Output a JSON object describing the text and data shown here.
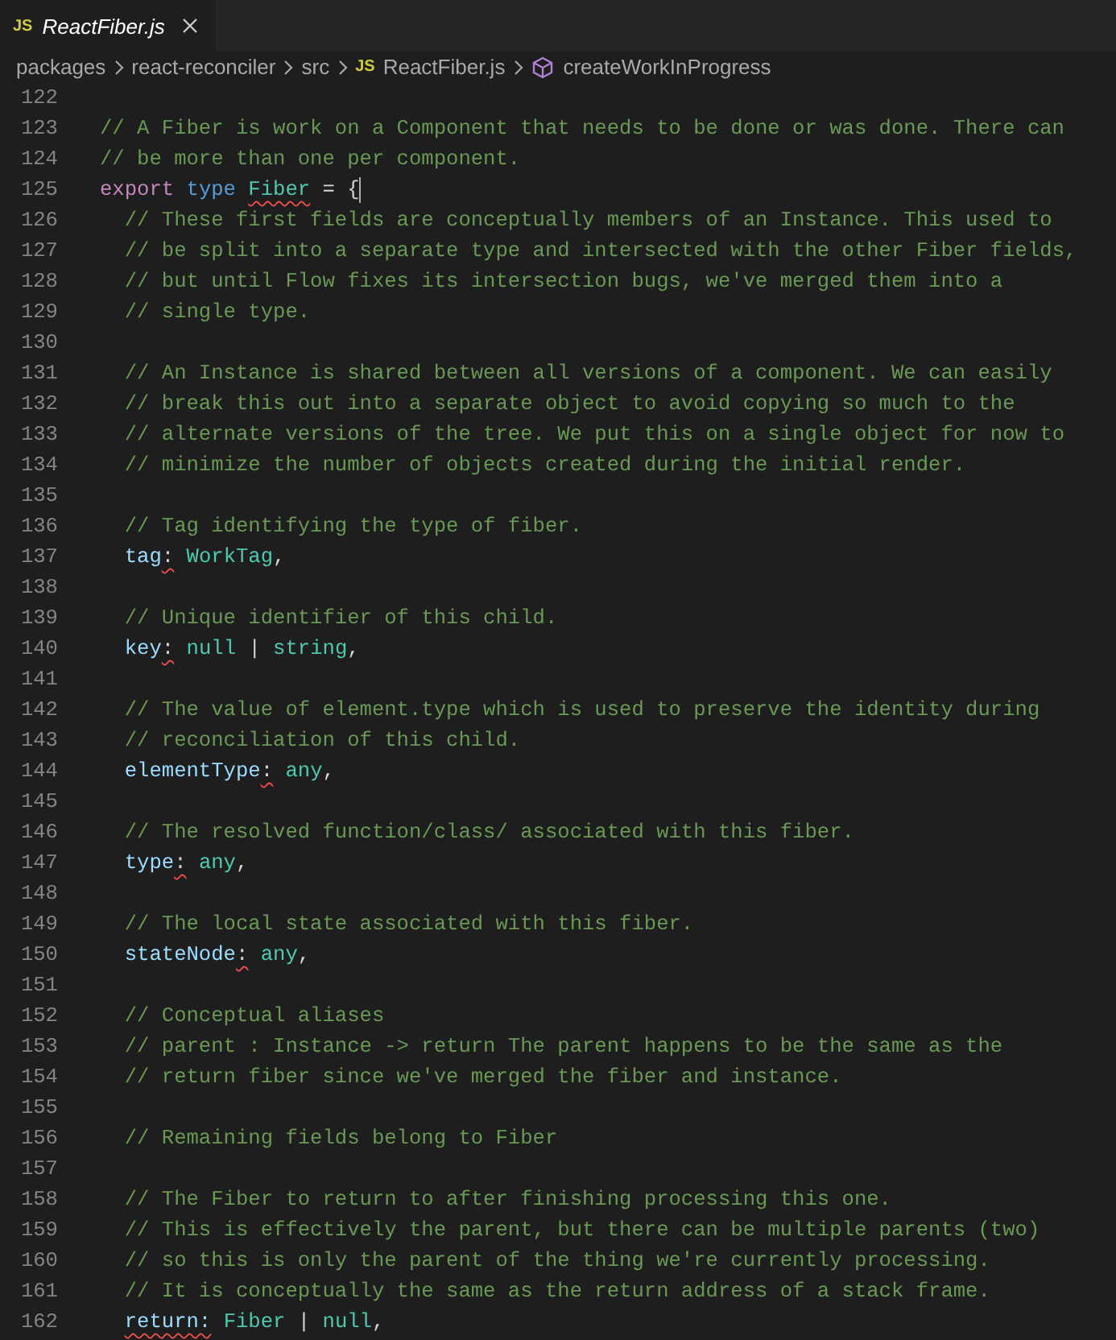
{
  "tabs": [
    {
      "badge": "JS",
      "label": "ReactFiber.js",
      "selected": true,
      "preview": true
    }
  ],
  "breadcrumb": [
    {
      "kind": "folder",
      "label": "packages"
    },
    {
      "kind": "folder",
      "label": "react-reconciler"
    },
    {
      "kind": "folder",
      "label": "src"
    },
    {
      "kind": "file",
      "badge": "JS",
      "label": "ReactFiber.js"
    },
    {
      "kind": "symbol",
      "label": "createWorkInProgress"
    }
  ],
  "lines": [
    {
      "number": "122"
    },
    {
      "number": "123",
      "tokens": [
        {
          "kind": "comment",
          "text": "// A Fiber is work on a Component that needs to be done or was done. There can",
          "squiggle": false
        }
      ]
    },
    {
      "number": "124",
      "tokens": [
        {
          "kind": "comment",
          "text": "// be more than one per component.",
          "squiggle": false
        }
      ]
    },
    {
      "number": "125",
      "tokens": [
        {
          "kind": "keyword",
          "text": "export ",
          "squiggle": false
        },
        {
          "kind": "storage",
          "text": "type ",
          "squiggle": false
        },
        {
          "kind": "type",
          "text": "Fiber",
          "squiggle": true
        },
        {
          "kind": "punct",
          "text": " = {",
          "squiggle": false,
          "caret": true
        }
      ]
    },
    {
      "number": "126",
      "tokens": [
        {
          "kind": "comment",
          "text": "  // These first fields are conceptually members of an Instance. This used to",
          "squiggle": false
        }
      ]
    },
    {
      "number": "127",
      "tokens": [
        {
          "kind": "comment",
          "text": "  // be split into a separate type and intersected with the other Fiber fields,",
          "squiggle": false
        }
      ]
    },
    {
      "number": "128",
      "tokens": [
        {
          "kind": "comment",
          "text": "  // but until Flow fixes its intersection bugs, we've merged them into a",
          "squiggle": false
        }
      ]
    },
    {
      "number": "129",
      "tokens": [
        {
          "kind": "comment",
          "text": "  // single type.",
          "squiggle": false
        }
      ]
    },
    {
      "number": "130"
    },
    {
      "number": "131",
      "tokens": [
        {
          "kind": "comment",
          "text": "  // An Instance is shared between all versions of a component. We can easily",
          "squiggle": false
        }
      ]
    },
    {
      "number": "132",
      "tokens": [
        {
          "kind": "comment",
          "text": "  // break this out into a separate object to avoid copying so much to the",
          "squiggle": false
        }
      ]
    },
    {
      "number": "133",
      "tokens": [
        {
          "kind": "comment",
          "text": "  // alternate versions of the tree. We put this on a single object for now to",
          "squiggle": false
        }
      ]
    },
    {
      "number": "134",
      "tokens": [
        {
          "kind": "comment",
          "text": "  // minimize the number of objects created during the initial render.",
          "squiggle": false
        }
      ]
    },
    {
      "number": "135"
    },
    {
      "number": "136",
      "tokens": [
        {
          "kind": "comment",
          "text": "  // Tag identifying the type of fiber.",
          "squiggle": false
        }
      ]
    },
    {
      "number": "137",
      "tokens": [
        {
          "kind": "property",
          "text": "  tag",
          "squiggle": false
        },
        {
          "kind": "punct",
          "text": ":",
          "squiggle": true
        },
        {
          "kind": "type",
          "text": " WorkTag",
          "squiggle": false
        },
        {
          "kind": "punct",
          "text": ",",
          "squiggle": false
        }
      ]
    },
    {
      "number": "138"
    },
    {
      "number": "139",
      "tokens": [
        {
          "kind": "comment",
          "text": "  // Unique identifier of this child.",
          "squiggle": false
        }
      ]
    },
    {
      "number": "140",
      "tokens": [
        {
          "kind": "property",
          "text": "  key",
          "squiggle": false
        },
        {
          "kind": "punct",
          "text": ":",
          "squiggle": true
        },
        {
          "kind": "type",
          "text": " null",
          "squiggle": false
        },
        {
          "kind": "punct",
          "text": " | ",
          "squiggle": false
        },
        {
          "kind": "type",
          "text": "string",
          "squiggle": false
        },
        {
          "kind": "punct",
          "text": ",",
          "squiggle": false
        }
      ]
    },
    {
      "number": "141"
    },
    {
      "number": "142",
      "tokens": [
        {
          "kind": "comment",
          "text": "  // The value of element.type which is used to preserve the identity during",
          "squiggle": false
        }
      ]
    },
    {
      "number": "143",
      "tokens": [
        {
          "kind": "comment",
          "text": "  // reconciliation of this child.",
          "squiggle": false
        }
      ]
    },
    {
      "number": "144",
      "tokens": [
        {
          "kind": "property",
          "text": "  elementType",
          "squiggle": false
        },
        {
          "kind": "punct",
          "text": ":",
          "squiggle": true
        },
        {
          "kind": "type",
          "text": " any",
          "squiggle": false
        },
        {
          "kind": "punct",
          "text": ",",
          "squiggle": false
        }
      ]
    },
    {
      "number": "145"
    },
    {
      "number": "146",
      "tokens": [
        {
          "kind": "comment",
          "text": "  // The resolved function/class/ associated with this fiber.",
          "squiggle": false
        }
      ]
    },
    {
      "number": "147",
      "tokens": [
        {
          "kind": "property",
          "text": "  type",
          "squiggle": false
        },
        {
          "kind": "punct",
          "text": ":",
          "squiggle": true
        },
        {
          "kind": "type",
          "text": " any",
          "squiggle": false
        },
        {
          "kind": "punct",
          "text": ",",
          "squiggle": false
        }
      ]
    },
    {
      "number": "148"
    },
    {
      "number": "149",
      "tokens": [
        {
          "kind": "comment",
          "text": "  // The local state associated with this fiber.",
          "squiggle": false
        }
      ]
    },
    {
      "number": "150",
      "tokens": [
        {
          "kind": "property",
          "text": "  stateNode",
          "squiggle": false
        },
        {
          "kind": "punct",
          "text": ":",
          "squiggle": true
        },
        {
          "kind": "type",
          "text": " any",
          "squiggle": false
        },
        {
          "kind": "punct",
          "text": ",",
          "squiggle": false
        }
      ]
    },
    {
      "number": "151"
    },
    {
      "number": "152",
      "tokens": [
        {
          "kind": "comment",
          "text": "  // Conceptual aliases",
          "squiggle": false
        }
      ]
    },
    {
      "number": "153",
      "tokens": [
        {
          "kind": "comment",
          "text": "  // parent : Instance -> return The parent happens to be the same as the",
          "squiggle": false
        }
      ]
    },
    {
      "number": "154",
      "tokens": [
        {
          "kind": "comment",
          "text": "  // return fiber since we've merged the fiber and instance.",
          "squiggle": false
        }
      ]
    },
    {
      "number": "155"
    },
    {
      "number": "156",
      "tokens": [
        {
          "kind": "comment",
          "text": "  // Remaining fields belong to Fiber",
          "squiggle": false
        }
      ]
    },
    {
      "number": "157"
    },
    {
      "number": "158",
      "tokens": [
        {
          "kind": "comment",
          "text": "  // The Fiber to return to after finishing processing this one.",
          "squiggle": false
        }
      ]
    },
    {
      "number": "159",
      "tokens": [
        {
          "kind": "comment",
          "text": "  // This is effectively the parent, but there can be multiple parents (two)",
          "squiggle": false
        }
      ]
    },
    {
      "number": "160",
      "tokens": [
        {
          "kind": "comment",
          "text": "  // so this is only the parent of the thing we're currently processing.",
          "squiggle": false
        }
      ]
    },
    {
      "number": "161",
      "tokens": [
        {
          "kind": "comment",
          "text": "  // It is conceptually the same as the return address of a stack frame.",
          "squiggle": false
        }
      ]
    },
    {
      "number": "162",
      "tokens": [
        {
          "kind": "property",
          "text": "  return:",
          "squiggle": true
        },
        {
          "kind": "type",
          "text": " Fiber",
          "squiggle": false
        },
        {
          "kind": "punct",
          "text": " | ",
          "squiggle": false
        },
        {
          "kind": "type",
          "text": "null",
          "squiggle": false
        },
        {
          "kind": "punct",
          "text": ",",
          "squiggle": false
        }
      ]
    }
  ]
}
